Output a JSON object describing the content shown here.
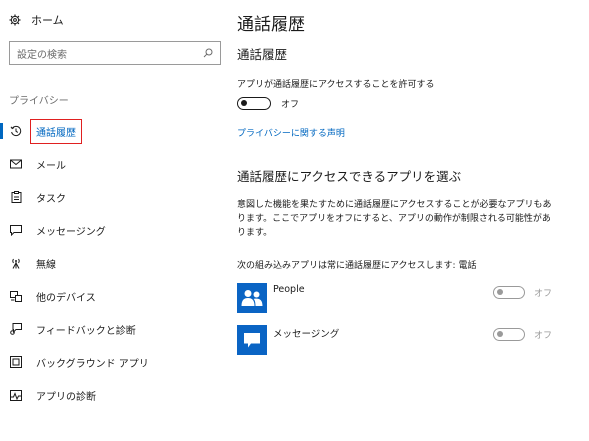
{
  "sidebar": {
    "home_label": "ホーム",
    "search_placeholder": "設定の検索",
    "section_label": "プライバシー",
    "items": [
      {
        "label": "通話履歴",
        "icon": "history-icon",
        "active": true
      },
      {
        "label": "メール",
        "icon": "mail-icon"
      },
      {
        "label": "タスク",
        "icon": "task-icon"
      },
      {
        "label": "メッセージング",
        "icon": "chat-icon"
      },
      {
        "label": "無線",
        "icon": "radio-icon"
      },
      {
        "label": "他のデバイス",
        "icon": "devices-icon"
      },
      {
        "label": "フィードバックと診断",
        "icon": "feedback-icon"
      },
      {
        "label": "バックグラウンド アプリ",
        "icon": "background-apps-icon"
      },
      {
        "label": "アプリの診断",
        "icon": "app-diagnostics-icon"
      }
    ]
  },
  "main": {
    "title": "通話履歴",
    "subtitle": "通話履歴",
    "allow_desc": "アプリが通話履歴にアクセスすることを許可する",
    "allow_state": "オフ",
    "privacy_link": "プライバシーに関する声明",
    "choose_heading": "通話履歴にアクセスできるアプリを選ぶ",
    "choose_paragraph": "意図した機能を果たすために通話履歴にアクセスすることが必要なアプリもあります。ここでアプリをオフにすると、アプリの動作が制限される可能性があります。",
    "builtin_note": "次の組み込みアプリは常に通話履歴にアクセスします: 電話",
    "apps": [
      {
        "name": "People",
        "state": "オフ",
        "icon": "people-icon"
      },
      {
        "name": "メッセージング",
        "state": "オフ",
        "icon": "messaging-icon"
      }
    ]
  },
  "colors": {
    "accent": "#0067c0",
    "tile": "#0a64c4",
    "highlight_box": "#e02020"
  }
}
